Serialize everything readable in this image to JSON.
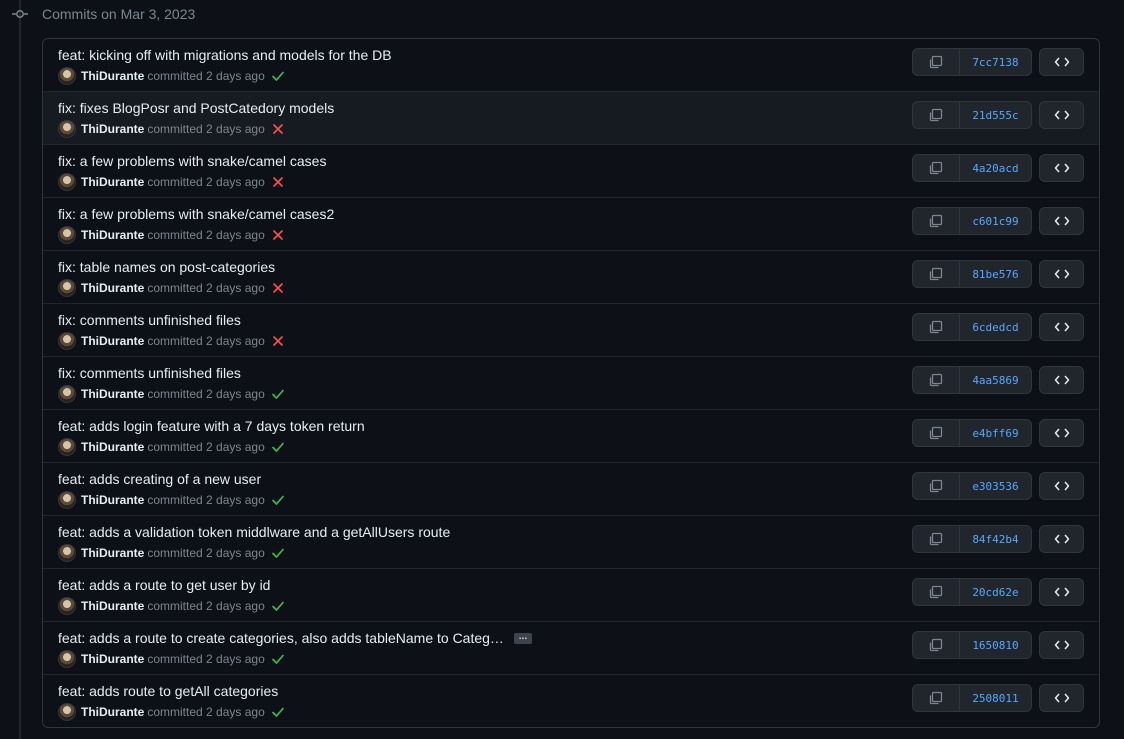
{
  "group_header": "Commits on Mar 3, 2023",
  "colors": {
    "success": "#3fb950",
    "failure": "#f85149",
    "sha": "#58a6ff"
  },
  "commits": [
    {
      "title": "feat: kicking off with migrations and models for the DB",
      "author": "ThiDurante",
      "action": "committed",
      "time": "2 days ago",
      "status": "success",
      "sha": "7cc7138"
    },
    {
      "title": "fix: fixes BlogPosr and PostCatedory models",
      "author": "ThiDurante",
      "action": "committed",
      "time": "2 days ago",
      "status": "failure",
      "sha": "21d555c"
    },
    {
      "title": "fix: a few problems with snake/camel cases",
      "author": "ThiDurante",
      "action": "committed",
      "time": "2 days ago",
      "status": "failure",
      "sha": "4a20acd"
    },
    {
      "title": "fix: a few problems with snake/camel cases2",
      "author": "ThiDurante",
      "action": "committed",
      "time": "2 days ago",
      "status": "failure",
      "sha": "c601c99"
    },
    {
      "title": "fix: table names on post-categories",
      "author": "ThiDurante",
      "action": "committed",
      "time": "2 days ago",
      "status": "failure",
      "sha": "81be576"
    },
    {
      "title": "fix: comments unfinished files",
      "author": "ThiDurante",
      "action": "committed",
      "time": "2 days ago",
      "status": "failure",
      "sha": "6cdedcd"
    },
    {
      "title": "fix: comments unfinished files",
      "author": "ThiDurante",
      "action": "committed",
      "time": "2 days ago",
      "status": "success",
      "sha": "4aa5869"
    },
    {
      "title": "feat: adds login feature with a 7 days token return",
      "author": "ThiDurante",
      "action": "committed",
      "time": "2 days ago",
      "status": "success",
      "sha": "e4bff69"
    },
    {
      "title": "feat: adds creating of a new user",
      "author": "ThiDurante",
      "action": "committed",
      "time": "2 days ago",
      "status": "success",
      "sha": "e303536"
    },
    {
      "title": "feat: adds a validation token middlware and a getAllUsers route",
      "author": "ThiDurante",
      "action": "committed",
      "time": "2 days ago",
      "status": "success",
      "sha": "84f42b4"
    },
    {
      "title": "feat: adds a route to get user by id",
      "author": "ThiDurante",
      "action": "committed",
      "time": "2 days ago",
      "status": "success",
      "sha": "20cd62e"
    },
    {
      "title": "feat: adds a route to create categories, also adds tableName to Categ…",
      "author": "ThiDurante",
      "action": "committed",
      "time": "2 days ago",
      "status": "success",
      "sha": "1650810",
      "truncated": true,
      "ellipsis_label": "…"
    },
    {
      "title": "feat: adds route to getAll categories",
      "author": "ThiDurante",
      "action": "committed",
      "time": "2 days ago",
      "status": "success",
      "sha": "2508011"
    }
  ]
}
